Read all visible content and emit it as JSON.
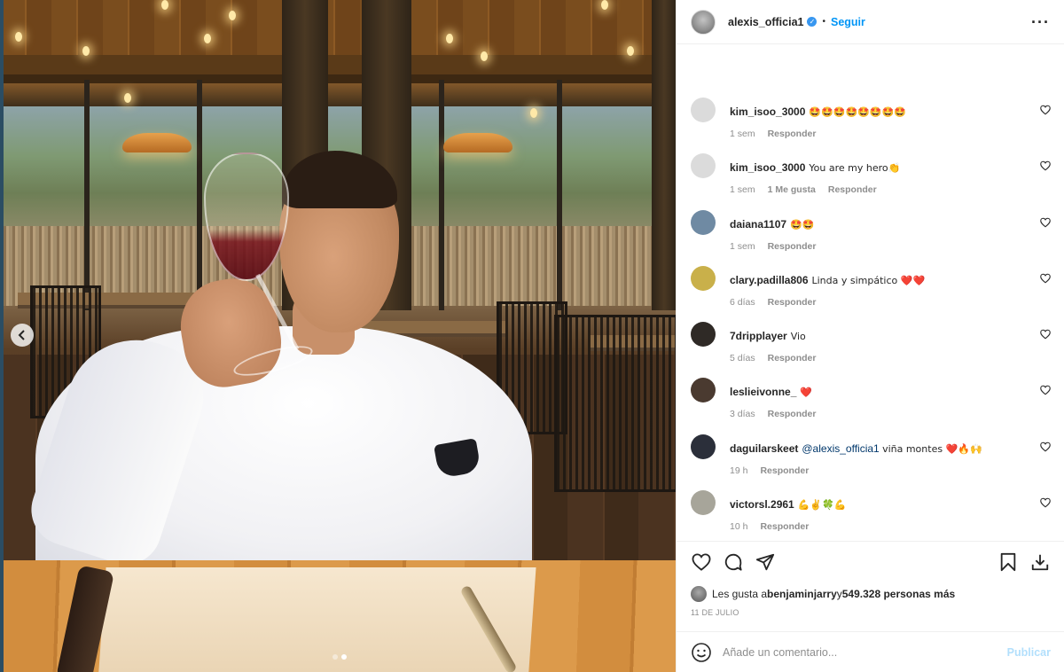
{
  "post": {
    "username": "alexis_officia1",
    "verified": true,
    "separator": "•",
    "follow_label": "Seguir",
    "more_label": "···"
  },
  "comments": [
    {
      "user": "kim_isoo_3000",
      "text": "🤩🤩🤩🤩🤩🤩🤩🤩",
      "time": "1 sem",
      "likes": "",
      "reply": "Responder",
      "avatar_color": "#dbdbdb"
    },
    {
      "user": "kim_isoo_3000",
      "text": "You are my hero👏",
      "time": "1 sem",
      "likes": "1 Me gusta",
      "reply": "Responder",
      "avatar_color": "#dbdbdb"
    },
    {
      "user": "daiana1107",
      "text": "🤩🤩",
      "time": "1 sem",
      "likes": "",
      "reply": "Responder",
      "avatar_color": "#6f8aa3"
    },
    {
      "user": "clary.padilla806",
      "text": "Linda y simpático ❤️❤️",
      "time": "6 días",
      "likes": "",
      "reply": "Responder",
      "avatar_color": "#c9b04a"
    },
    {
      "user": "7dripplayer",
      "text": "Vio",
      "time": "5 días",
      "likes": "",
      "reply": "Responder",
      "avatar_color": "#2f2a26"
    },
    {
      "user": "leslieivonne_",
      "text": "❤️",
      "time": "3 días",
      "likes": "",
      "reply": "Responder",
      "avatar_color": "#4a3a30"
    },
    {
      "user": "daguilarskeet",
      "mention": "@alexis_officia1",
      "text": "viña montes ❤️🔥🙌",
      "time": "19 h",
      "likes": "",
      "reply": "Responder",
      "avatar_color": "#2b2f3a"
    },
    {
      "user": "victorsl.2961",
      "text": "💪✌️🍀💪",
      "time": "10 h",
      "likes": "",
      "reply": "Responder",
      "avatar_color": "#a7a59a"
    }
  ],
  "actions": {
    "like_icon": "heart-outline-icon",
    "comment_icon": "comment-icon",
    "share_icon": "send-icon",
    "save_icon": "bookmark-icon",
    "download_icon": "download-icon"
  },
  "likes": {
    "prefix": "Les gusta a ",
    "first_user": "benjaminjarry",
    "middle": " y ",
    "count_text": "549.328 personas más"
  },
  "date": "11 DE JULIO",
  "add_comment": {
    "placeholder": "Añade un comentario...",
    "publish_label": "Publicar"
  },
  "carousel": {
    "total": 2,
    "active_index": 1
  },
  "colors": {
    "accent": "#0095f6",
    "verified": "#3897f0",
    "publish_disabled": "#b2dffc",
    "secondary_text": "#8e8e8e"
  }
}
